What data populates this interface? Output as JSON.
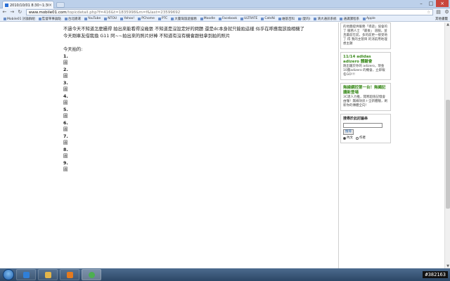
{
  "browser": {
    "tab_title": "2010/10/01 8:30~1:30 平...",
    "url_host": "www.mobile01.com",
    "url_path": "/topicdetail.php?f=416&t=1835998&m=f&last=23599692"
  },
  "bookmarks": [
    {
      "label": "Mobile01 討論群組"
    },
    {
      "label": "監督單事論點"
    },
    {
      "label": "台北捷運"
    },
    {
      "label": "YouTube"
    },
    {
      "label": "NTOU"
    },
    {
      "label": "Yahoo!"
    },
    {
      "label": "PChome"
    },
    {
      "label": "PTC"
    },
    {
      "label": "大臺灣旅遊服務"
    },
    {
      "label": "Moodle"
    },
    {
      "label": "Facebook"
    },
    {
      "label": "ULTRATE"
    },
    {
      "label": "CatsNi"
    },
    {
      "label": "維基百科"
    },
    {
      "label": "(愛的)"
    },
    {
      "label": "清大通訊系統"
    },
    {
      "label": "通識課程系"
    },
    {
      "label": "Apple"
    }
  ],
  "bookmarks_other": "其他書籤",
  "post": {
    "line1": "不過今天不知道怎麼攝得 拍出來能看得沒幾張 不知道是沒設定好的問題 還是dc本身就只能拍這樣 似乎在呼應我該換相機了",
    "line2": "今天剛車友借我換 G11 阿~~拍出來的照片好棒 不知道有沒有機會跟他拿到拍的照片",
    "today_label": "今天拍的:",
    "items": [
      {
        "num": "1.",
        "caption": "圖"
      },
      {
        "num": "2.",
        "caption": "圖"
      },
      {
        "num": "3.",
        "caption": "圖"
      },
      {
        "num": "4.",
        "caption": "圖"
      },
      {
        "num": "5.",
        "caption": "圖"
      },
      {
        "num": "6.",
        "caption": "圖"
      },
      {
        "num": "7.",
        "caption": "圖"
      },
      {
        "num": "8.",
        "caption": "圖"
      },
      {
        "num": "9.",
        "caption": "圖"
      }
    ]
  },
  "sidebar": {
    "ad1_text": "的地圖提供服務「導遊」協會的了 服務人士 「最後」 道服。並且最前在前，多的前更一接受地了 得 我的主管目 的消前用地理想主題",
    "ad2_title": "11/14 adidas adizero 體驗會",
    "ad2_text": "跑出屬於你的 adizero，現金10團adizero 的機會，立即報名GO!!!",
    "ad3_title": "無線網控第一台！無繩記讀新登場",
    "ad3_text": "3C達人力推，開寒超值記憶會由懂！無線效訊＋全新體驗，刷新你的傳體全向！",
    "subscribe_title": "搜尋於此討論串",
    "search_btn": "搜尋",
    "radio_content": "內文",
    "radio_author": "作者"
  },
  "taskbar": {
    "tray_text": "#382163"
  }
}
